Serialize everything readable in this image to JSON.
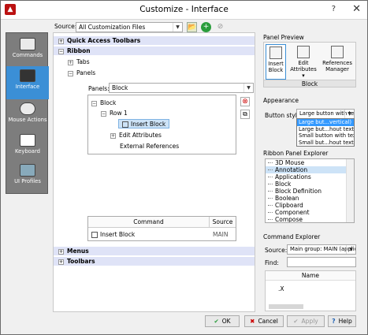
{
  "window": {
    "title": "Customize - Interface",
    "help_glyph": "?",
    "close_glyph": "✕",
    "app_glyph": "▲"
  },
  "source": {
    "label": "Source:",
    "value": "All Customization Files"
  },
  "nav": {
    "items": [
      {
        "label": "Commands",
        "icon": "commands-icon"
      },
      {
        "label": "Interface",
        "icon": "monitor-icon"
      },
      {
        "label": "Mouse Actions",
        "icon": "mouse-icon"
      },
      {
        "label": "Keyboard",
        "icon": "keyboard-icon"
      },
      {
        "label": "UI Profiles",
        "icon": "profiles-icon"
      }
    ]
  },
  "tree": {
    "quick_access": "Quick Access Toolbars",
    "ribbon": "Ribbon",
    "tabs": "Tabs",
    "panels": "Panels",
    "menus": "Menus",
    "toolbars": "Toolbars"
  },
  "panels_select": {
    "label": "Panels:",
    "value": "Block"
  },
  "panel_tree": {
    "block": "Block",
    "row": "Row 1",
    "insert_block": "Insert Block",
    "edit_attributes": "Edit Attributes",
    "external_references": "External References"
  },
  "command_table": {
    "headers": [
      "Command",
      "Source"
    ],
    "rows": [
      {
        "command": "Insert Block",
        "source": "MAIN"
      }
    ]
  },
  "panel_preview": {
    "title": "Panel Preview",
    "buttons": [
      "Insert Block",
      "Edit Attributes ▾",
      "References Manager"
    ],
    "group_label": "Block"
  },
  "appearance": {
    "title": "Appearance",
    "button_style_label": "Button style:",
    "button_style_value": "Large button with te",
    "options": [
      "Large but...vertical)",
      "Large but...hout text",
      "Small button with text",
      "Small but...hout text"
    ]
  },
  "ribbon_explorer": {
    "title": "Ribbon Panel Explorer",
    "items": [
      "3D Mouse",
      "Annotation",
      "Applications",
      "Block",
      "Block Definition",
      "Boolean",
      "Clipboard",
      "Component",
      "Compose"
    ]
  },
  "command_explorer": {
    "title": "Command Explorer",
    "source_label": "Source:",
    "source_value": "Main group: MAIN (applic",
    "find_label": "Find:",
    "column_header": "Name",
    "first_row": ".X"
  },
  "buttons": {
    "ok": "OK",
    "cancel": "Cancel",
    "apply": "Apply",
    "help": "Help"
  }
}
